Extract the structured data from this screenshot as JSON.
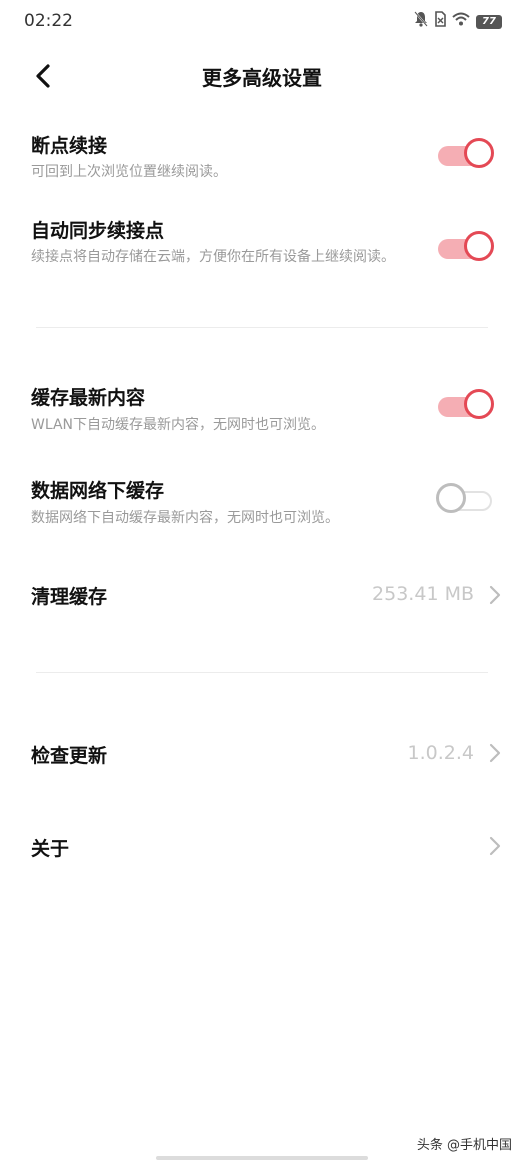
{
  "status_bar": {
    "time": "02:22",
    "battery": "77",
    "icons": [
      "bell-off-icon",
      "sim-icon",
      "wifi-icon",
      "battery-icon"
    ]
  },
  "header": {
    "title": "更多高级设置"
  },
  "settings": {
    "resume_reading": {
      "title": "断点续接",
      "subtitle": "可回到上次浏览位置继续阅读。",
      "enabled": true
    },
    "sync_resume": {
      "title": "自动同步续接点",
      "subtitle": "续接点将自动存储在云端，方便你在所有设备上继续阅读。",
      "enabled": true
    },
    "cache_latest": {
      "title": "缓存最新内容",
      "subtitle": "WLAN下自动缓存最新内容，无网时也可浏览。",
      "enabled": true
    },
    "mobile_cache": {
      "title": "数据网络下缓存",
      "subtitle": "数据网络下自动缓存最新内容，无网时也可浏览。",
      "enabled": false
    },
    "clear_cache": {
      "title": "清理缓存",
      "value": "253.41 MB"
    },
    "check_update": {
      "title": "检查更新",
      "value": "1.0.2.4"
    },
    "about": {
      "title": "关于"
    }
  },
  "watermark": "头条 @手机中国",
  "colors": {
    "accent": "#e44955",
    "accent_track": "#f5aeb4",
    "subtitle": "#9a9a9a",
    "value": "#c8c8c8"
  }
}
